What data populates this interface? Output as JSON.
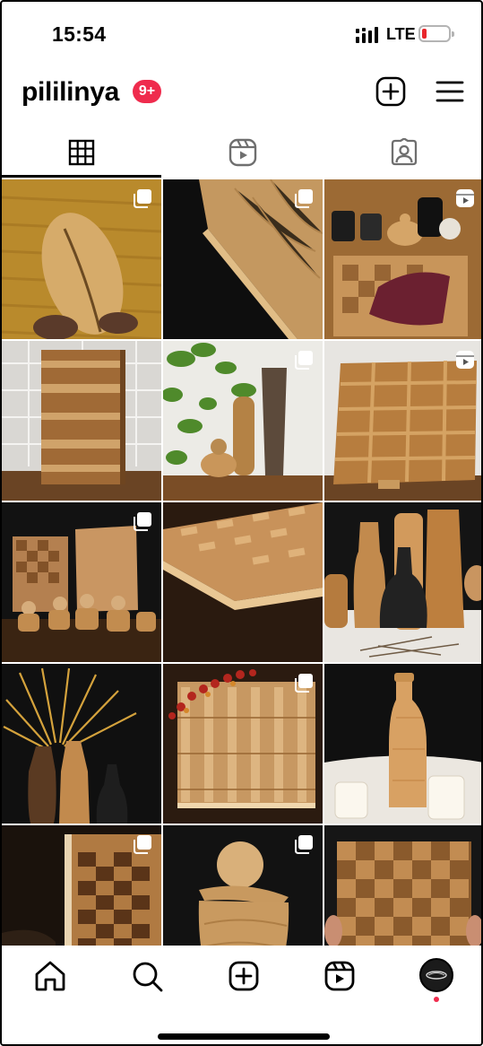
{
  "status_bar": {
    "time": "15:54",
    "network": "LTE",
    "battery_state": "low",
    "battery_color": "#e8262b"
  },
  "header": {
    "username": "pililinya",
    "notification_badge": "9+",
    "badge_color": "#ef2b4d"
  },
  "tabs": [
    {
      "name": "posts-grid",
      "icon": "grid-icon",
      "active": true
    },
    {
      "name": "reels",
      "icon": "reels-icon",
      "active": false
    },
    {
      "name": "tagged",
      "icon": "tagged-person-icon",
      "active": false
    }
  ],
  "posts": [
    {
      "subject": "wooden bowl held in hands",
      "type": "carousel"
    },
    {
      "subject": "cutting board corner on black",
      "type": "carousel"
    },
    {
      "subject": "cutting board with meat and jars",
      "type": "reel"
    },
    {
      "subject": "end grain board against tiles",
      "type": "image"
    },
    {
      "subject": "vases and plant on shelf",
      "type": "carousel"
    },
    {
      "subject": "end grain board on stand",
      "type": "reel"
    },
    {
      "subject": "boards and mortars on table",
      "type": "carousel"
    },
    {
      "subject": "board edge close-up",
      "type": "image"
    },
    {
      "subject": "wooden and black vases",
      "type": "image"
    },
    {
      "subject": "vases with dried palm leaf",
      "type": "image"
    },
    {
      "subject": "board with dried flowers",
      "type": "carousel"
    },
    {
      "subject": "tall bottle vase with candles",
      "type": "image"
    },
    {
      "subject": "board side close-up",
      "type": "carousel"
    },
    {
      "subject": "mortar and pestle",
      "type": "carousel"
    },
    {
      "subject": "checkered board held up",
      "type": "image"
    }
  ],
  "bottom_nav": [
    {
      "name": "home",
      "icon": "home-icon"
    },
    {
      "name": "search",
      "icon": "search-icon"
    },
    {
      "name": "create",
      "icon": "new-post-icon"
    },
    {
      "name": "reels",
      "icon": "reels-icon"
    },
    {
      "name": "profile",
      "icon": "profile-avatar"
    }
  ],
  "colors": {
    "accent": "#ef2b4d",
    "wood_light": "#d8b27a",
    "wood_dark": "#8a5a2c"
  }
}
